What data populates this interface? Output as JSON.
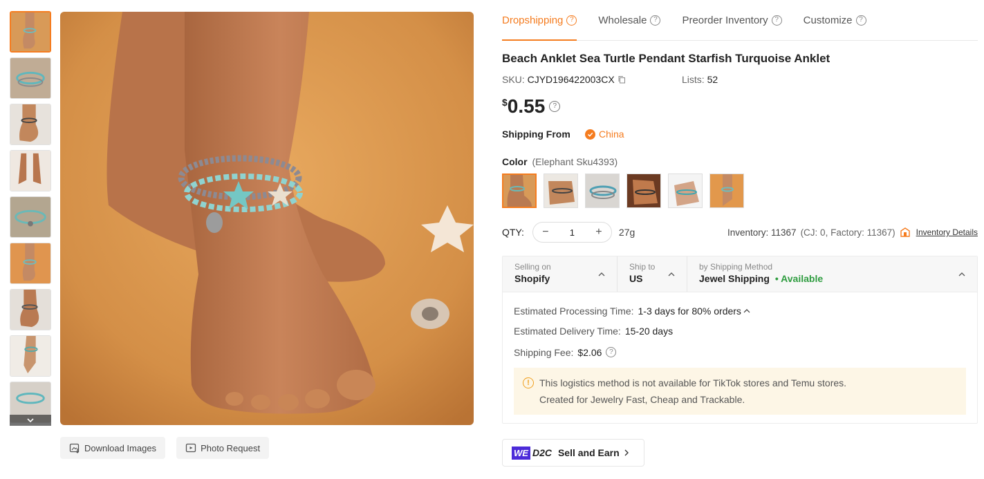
{
  "tabs": [
    {
      "label": "Dropshipping",
      "active": true
    },
    {
      "label": "Wholesale",
      "active": false
    },
    {
      "label": "Preorder Inventory",
      "active": false
    },
    {
      "label": "Customize",
      "active": false
    }
  ],
  "product": {
    "title": "Beach Anklet Sea Turtle Pendant Starfish Turquoise Anklet",
    "sku_label": "SKU:",
    "sku": "CJYD196422003CX",
    "lists_label": "Lists:",
    "lists": "52",
    "currency": "$",
    "price": "0.55"
  },
  "shipping_from": {
    "label": "Shipping From",
    "value": "China"
  },
  "color": {
    "label": "Color",
    "selected": "(Elephant Sku4393)",
    "swatch_count": 6
  },
  "quantity": {
    "label": "QTY:",
    "value": "1",
    "weight": "27g",
    "inventory": "Inventory: 11367",
    "breakdown": "(CJ: 0, Factory: 11367)",
    "details_link": "Inventory Details"
  },
  "shipping": {
    "selling_on_label": "Selling on",
    "selling_on": "Shopify",
    "ship_to_label": "Ship to",
    "ship_to": "US",
    "method_label": "by Shipping Method",
    "method": "Jewel Shipping",
    "availability": "• Available",
    "processing_label": "Estimated Processing Time:",
    "processing": "1-3 days for 80% orders",
    "delivery_label": "Estimated Delivery Time:",
    "delivery": "15-20 days",
    "fee_label": "Shipping Fee:",
    "fee": "$2.06",
    "notice_line1": "This logistics method is not available for TikTok stores and Temu stores.",
    "notice_line2": "Created for Jewelry Fast, Cheap and Trackable."
  },
  "image_actions": {
    "download": "Download Images",
    "photo_request": "Photo Request"
  },
  "d2c": {
    "we": "WE",
    "d2c": "D2C",
    "label": "Sell and Earn"
  },
  "colors": {
    "accent": "#f57c1f",
    "available": "#2e9c3f",
    "notice_bg": "#fdf6e6",
    "brand_we": "#4c2bd9"
  }
}
